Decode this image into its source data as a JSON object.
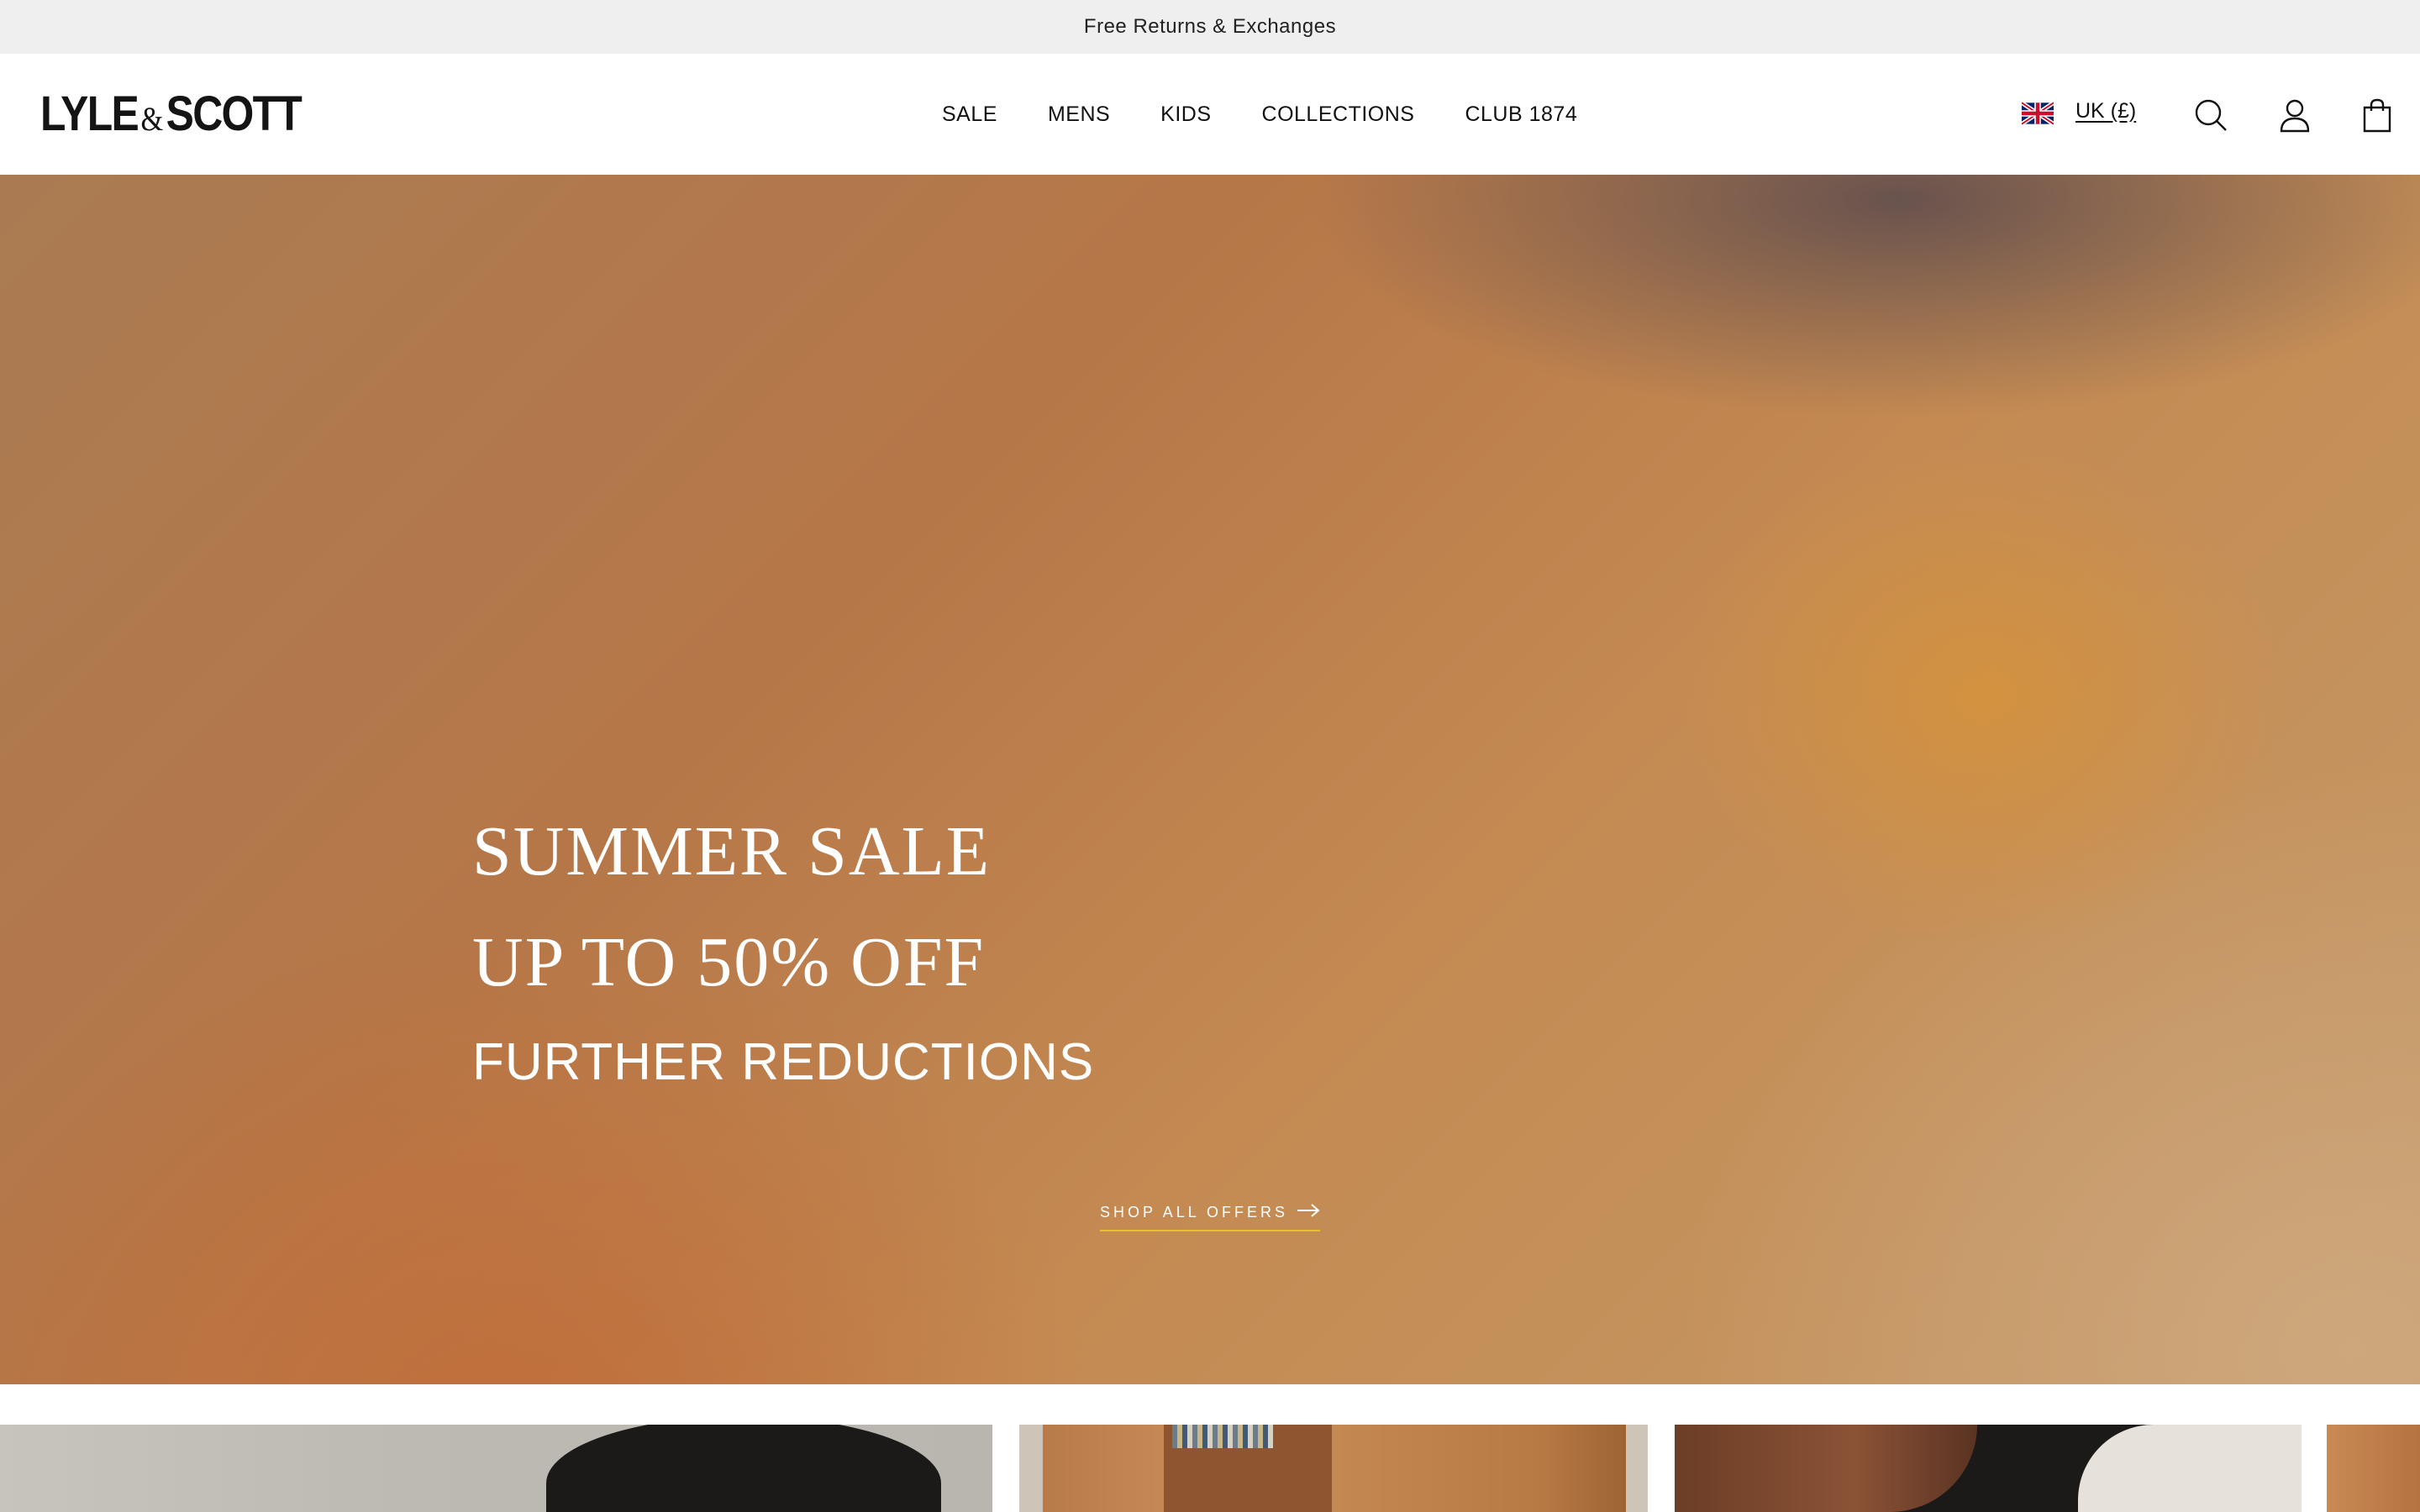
{
  "announcement": {
    "text": "Free Returns & Exchanges"
  },
  "header": {
    "logo": {
      "left": "LYLE",
      "amp": "&",
      "right": "SCOTT"
    },
    "nav": [
      {
        "label": "SALE"
      },
      {
        "label": "MENS"
      },
      {
        "label": "KIDS"
      },
      {
        "label": "COLLECTIONS"
      },
      {
        "label": "CLUB 1874"
      }
    ],
    "locale": {
      "label": "UK (£)",
      "flag": "uk-flag-icon"
    },
    "icons": {
      "search": "search-icon",
      "account": "account-icon",
      "bag": "shopping-bag-icon"
    }
  },
  "hero": {
    "title": "SUMMER SALE",
    "subtitle": "UP TO 50% OFF",
    "reductions": "FURTHER REDUCTIONS",
    "cta": {
      "label": "SHOP ALL OFFERS",
      "icon": "arrow-right-icon",
      "underline_color": "#e8c12a"
    }
  },
  "tiles": [
    {
      "name": "category-tile"
    },
    {
      "name": "category-tile"
    },
    {
      "name": "category-tile"
    },
    {
      "name": "category-tile"
    }
  ]
}
